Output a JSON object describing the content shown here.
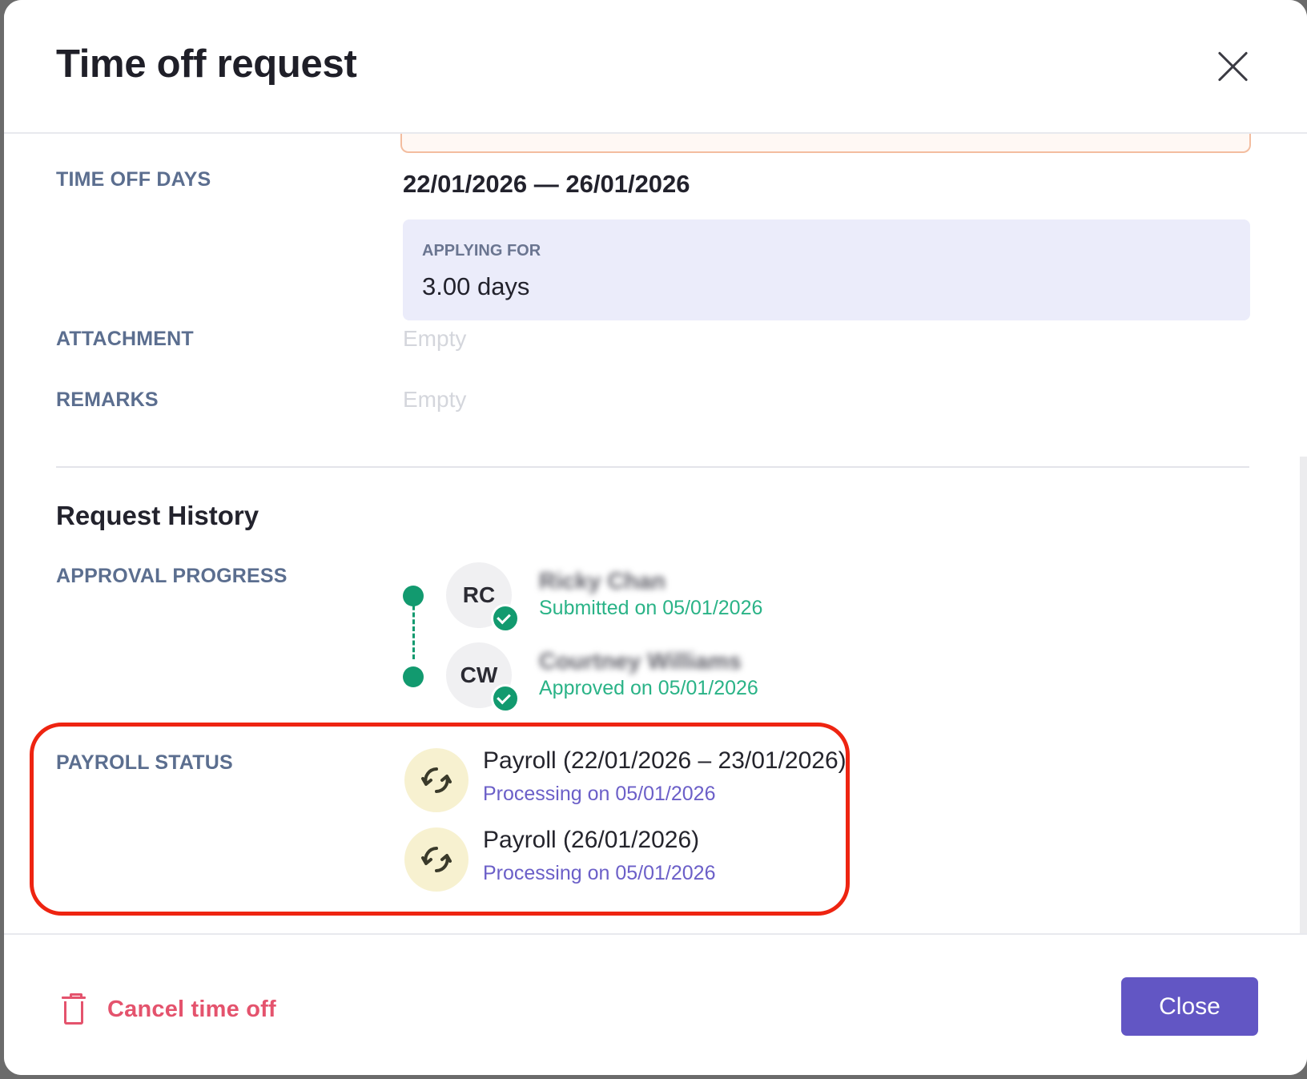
{
  "modal": {
    "title": "Time off request"
  },
  "details": {
    "time_off_days_label": "TIME OFF DAYS",
    "date_range": "22/01/2026 — 26/01/2026",
    "applying_for_label": "APPLYING FOR",
    "applying_for_value": "3.00 days",
    "attachment_label": "ATTACHMENT",
    "attachment_value": "Empty",
    "remarks_label": "REMARKS",
    "remarks_value": "Empty"
  },
  "history": {
    "title": "Request History",
    "approval_label": "APPROVAL PROGRESS",
    "approvers": [
      {
        "initials": "RC",
        "name": "Ricky Chan",
        "status": "Submitted on 05/01/2026"
      },
      {
        "initials": "CW",
        "name": "Courtney Williams",
        "status": "Approved on 05/01/2026"
      }
    ],
    "payroll_label": "PAYROLL STATUS",
    "payrolls": [
      {
        "title": "Payroll (22/01/2026 – 23/01/2026)",
        "status": "Processing on 05/01/2026"
      },
      {
        "title": "Payroll (26/01/2026)",
        "status": "Processing on 05/01/2026"
      }
    ]
  },
  "footer": {
    "cancel_label": "Cancel time off",
    "close_label": "Close"
  },
  "icons": {
    "close": "close-icon",
    "trash": "trash-icon",
    "sync": "sync-icon",
    "check": "check-circle-icon"
  },
  "colors": {
    "accent": "#6256c4",
    "success": "#129a6f",
    "danger": "#e4536d",
    "highlight": "#ee2411",
    "label": "#5b6e8f"
  }
}
